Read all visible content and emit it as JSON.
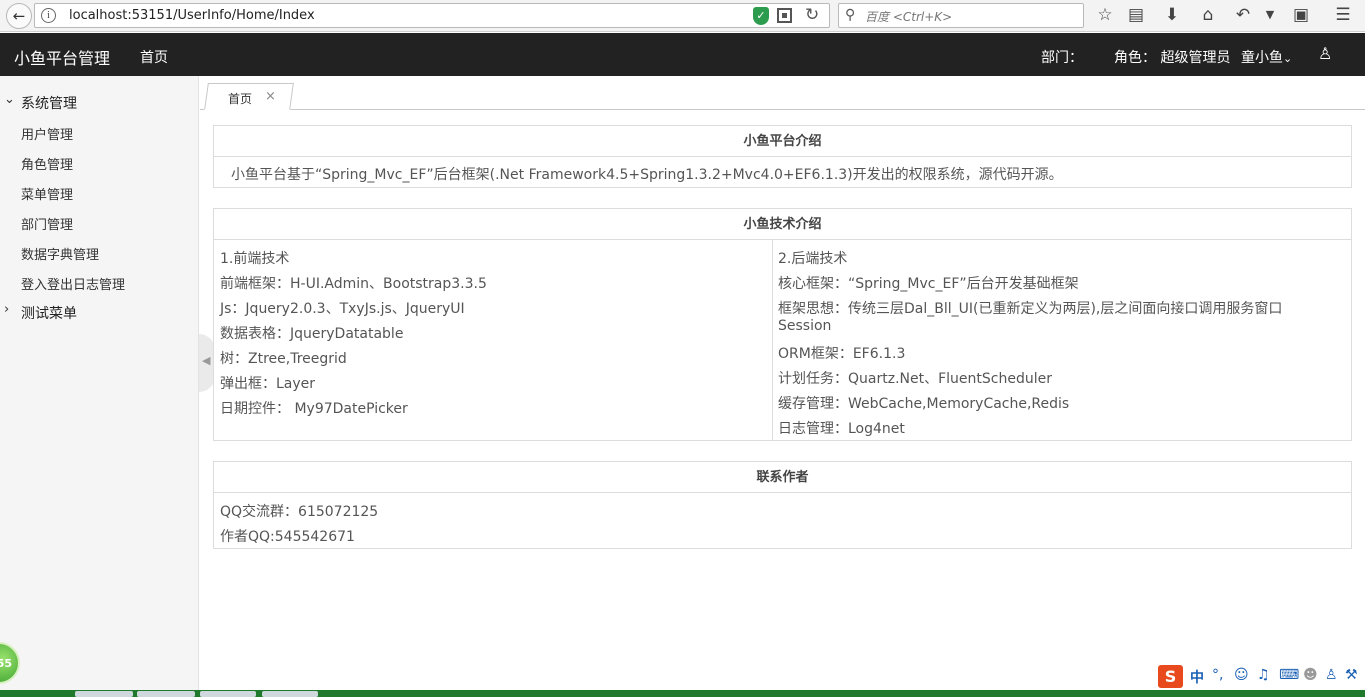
{
  "browser": {
    "url_host": "localhost",
    "url_rest": ":53151/UserInfo/Home/Index",
    "search_placeholder": "百度 <Ctrl+K>"
  },
  "header": {
    "title": "小鱼平台管理",
    "home": "首页",
    "dept": "部门：",
    "role": "角色： 超级管理员",
    "user": "童小鱼"
  },
  "sidebar": {
    "groups": [
      {
        "label": "系统管理",
        "expanded": true,
        "items": [
          "用户管理",
          "角色管理",
          "菜单管理",
          "部门管理",
          "数据字典管理",
          "登入登出日志管理"
        ]
      },
      {
        "label": "测试菜单",
        "expanded": false,
        "items": []
      }
    ]
  },
  "tabs": [
    {
      "label": "首页",
      "close": "×"
    }
  ],
  "panels": {
    "intro": {
      "title": "小鱼平台介绍",
      "text": "小鱼平台基于“Spring_Mvc_EF”后台框架(.Net Framework4.5+Spring1.3.2+Mvc4.0+EF6.1.3)开发出的权限系统，源代码开源。"
    },
    "tech": {
      "title": "小鱼技术介绍",
      "left": [
        "1.前端技术",
        "前端框架：H-UI.Admin、Bootstrap3.3.5",
        "Js：Jquery2.0.3、TxyJs.js、JqueryUI",
        "数据表格：JqueryDatatable",
        "树：Ztree,Treegrid",
        "弹出框：Layer",
        "日期控件： My97DatePicker"
      ],
      "right": [
        "2.后端技术",
        "核心框架：“Spring_Mvc_EF”后台开发基础框架",
        "框架思想：传统三层Dal_Bll_UI(已重新定义为两层),层之间面向接口调用服务窗口",
        "Session",
        "ORM框架：EF6.1.3",
        "计划任务：Quartz.Net、FluentScheduler",
        "缓存管理：WebCache,MemoryCache,Redis",
        "日志管理：Log4net"
      ]
    },
    "contact": {
      "title": "联系作者",
      "lines": [
        "QQ交流群：615072125",
        "作者QQ:545542671"
      ]
    }
  },
  "float_ball": "55",
  "ime": {
    "logo": "S",
    "lang": "中"
  }
}
